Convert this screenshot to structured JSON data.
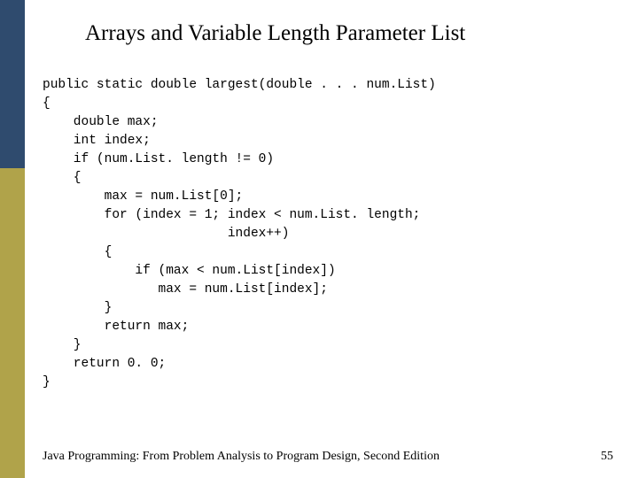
{
  "title": "Arrays and Variable Length Parameter List",
  "code": "public static double largest(double . . . num.List)\n{\n    double max;\n    int index;\n    if (num.List. length != 0)\n    {\n        max = num.List[0];\n        for (index = 1; index < num.List. length;\n                        index++)\n        {\n            if (max < num.List[index])\n               max = num.List[index];\n        }\n        return max;\n    }\n    return 0. 0;\n}",
  "footer": {
    "left": "Java Programming: From Problem Analysis to Program Design, Second Edition",
    "page": "55"
  }
}
